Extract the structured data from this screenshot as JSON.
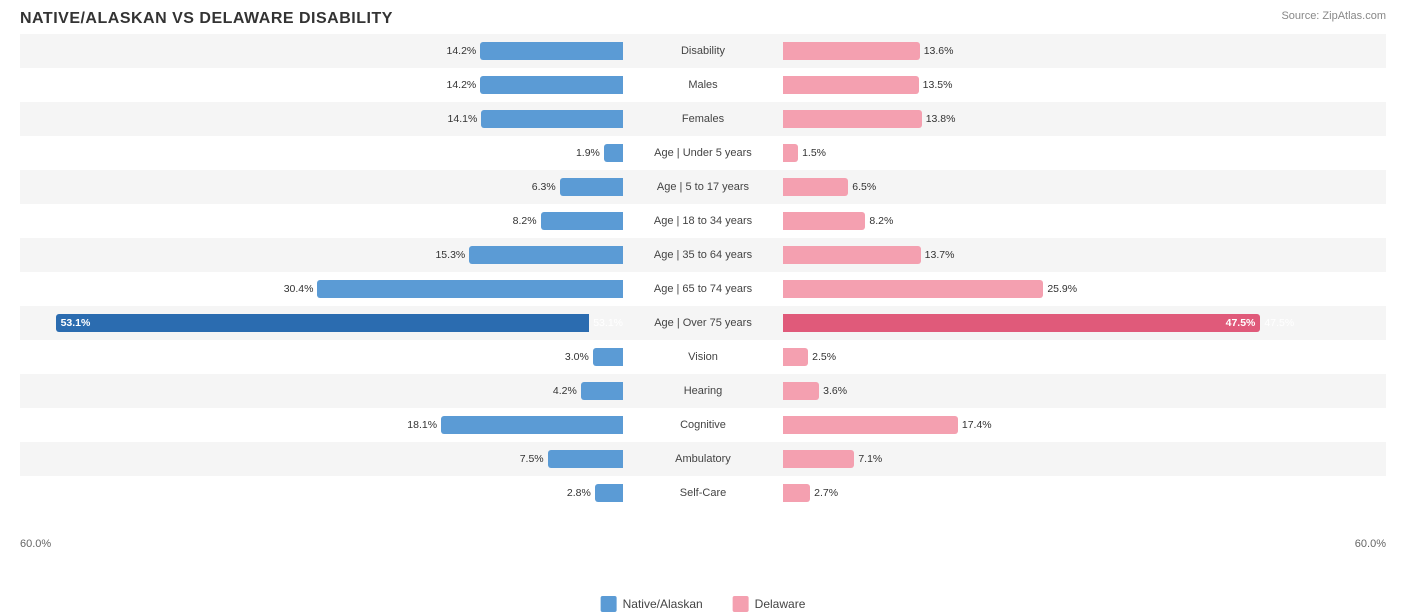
{
  "title": "NATIVE/ALASKAN VS DELAWARE DISABILITY",
  "source": "Source: ZipAtlas.com",
  "legend": {
    "left_label": "Native/Alaskan",
    "right_label": "Delaware",
    "left_color": "#5b9bd5",
    "right_color": "#f4a0b0"
  },
  "axis": {
    "left": "60.0%",
    "right": "60.0%"
  },
  "rows": [
    {
      "label": "Disability",
      "left_val": "14.2%",
      "right_val": "13.6%",
      "left_pct": 23.67,
      "right_pct": 22.67
    },
    {
      "label": "Males",
      "left_val": "14.2%",
      "right_val": "13.5%",
      "left_pct": 23.67,
      "right_pct": 22.5
    },
    {
      "label": "Females",
      "left_val": "14.1%",
      "right_val": "13.8%",
      "left_pct": 23.5,
      "right_pct": 23.0
    },
    {
      "label": "Age | Under 5 years",
      "left_val": "1.9%",
      "right_val": "1.5%",
      "left_pct": 3.17,
      "right_pct": 2.5
    },
    {
      "label": "Age | 5 to 17 years",
      "left_val": "6.3%",
      "right_val": "6.5%",
      "left_pct": 10.5,
      "right_pct": 10.83
    },
    {
      "label": "Age | 18 to 34 years",
      "left_val": "8.2%",
      "right_val": "8.2%",
      "left_pct": 13.67,
      "right_pct": 13.67
    },
    {
      "label": "Age | 35 to 64 years",
      "left_val": "15.3%",
      "right_val": "13.7%",
      "left_pct": 25.5,
      "right_pct": 22.83
    },
    {
      "label": "Age | 65 to 74 years",
      "left_val": "30.4%",
      "right_val": "25.9%",
      "left_pct": 50.67,
      "right_pct": 43.17
    },
    {
      "label": "Age | Over 75 years",
      "left_val": "53.1%",
      "right_val": "47.5%",
      "left_pct": 88.5,
      "right_pct": 79.17,
      "highlight": true
    },
    {
      "label": "Vision",
      "left_val": "3.0%",
      "right_val": "2.5%",
      "left_pct": 5.0,
      "right_pct": 4.17
    },
    {
      "label": "Hearing",
      "left_val": "4.2%",
      "right_val": "3.6%",
      "left_pct": 7.0,
      "right_pct": 6.0
    },
    {
      "label": "Cognitive",
      "left_val": "18.1%",
      "right_val": "17.4%",
      "left_pct": 30.17,
      "right_pct": 29.0
    },
    {
      "label": "Ambulatory",
      "left_val": "7.5%",
      "right_val": "7.1%",
      "left_pct": 12.5,
      "right_pct": 11.83
    },
    {
      "label": "Self-Care",
      "left_val": "2.8%",
      "right_val": "2.7%",
      "left_pct": 4.67,
      "right_pct": 4.5
    }
  ]
}
